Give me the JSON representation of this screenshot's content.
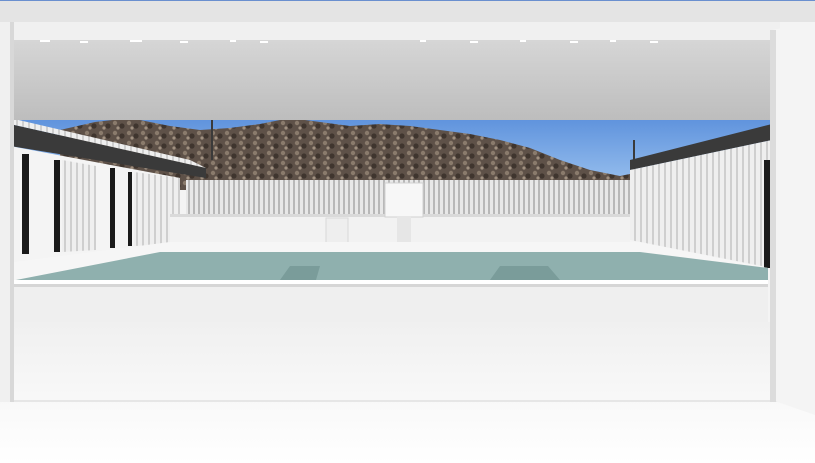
{
  "scene": {
    "description_icon": "architectural-render-icon",
    "colors": {
      "sky_top": "#4f86d8",
      "sky_bottom": "#9cc3ef",
      "mountain_dark": "#4a3f37",
      "mountain_light": "#8a7b6c",
      "pool_water": "#8fb0ae",
      "pool_water_dark": "#7a9c9a",
      "fence": "#d9d9d9",
      "roof_band": "#3a3a3a",
      "ceiling": "#c8c8c8",
      "floor": "#ffffff",
      "window_dark": "#1a1a1a"
    }
  }
}
